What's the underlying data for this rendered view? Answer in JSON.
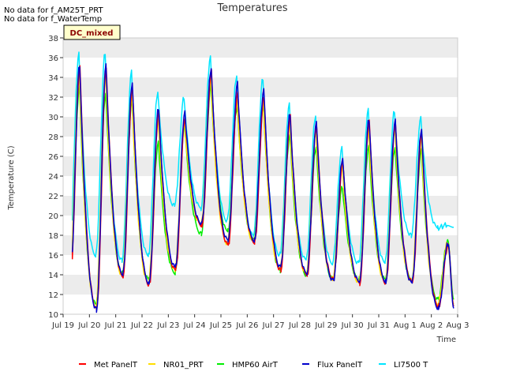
{
  "notices": [
    "No data for f_AM25T_PRT",
    "No data for f_WaterTemp"
  ],
  "badge": "DC_mixed",
  "chart_data": {
    "type": "line",
    "title": "Temperatures",
    "xlabel": "Time",
    "ylabel": "Temperature (C)",
    "ylim": [
      10,
      38
    ],
    "yticks": [
      10,
      12,
      14,
      16,
      18,
      20,
      22,
      24,
      26,
      28,
      30,
      32,
      34,
      36,
      38
    ],
    "xlim": [
      "2024-07-19",
      "2024-08-03"
    ],
    "xticks": [
      "Jul 19",
      "Jul 20",
      "Jul 21",
      "Jul 22",
      "Jul 23",
      "Jul 24",
      "Jul 25",
      "Jul 26",
      "Jul 27",
      "Jul 28",
      "Jul 29",
      "Jul 30",
      "Jul 31",
      "Aug 1",
      "Aug 2",
      "Aug 3"
    ],
    "grid": "horizontal bands",
    "legend": "bottom",
    "days": [
      "Jul 19",
      "Jul 20",
      "Jul 21",
      "Jul 22",
      "Jul 23",
      "Jul 24",
      "Jul 25",
      "Jul 26",
      "Jul 27",
      "Jul 28",
      "Jul 29",
      "Jul 30",
      "Jul 31",
      "Aug 1",
      "Aug 2"
    ],
    "series": [
      {
        "name": "Met PanelT",
        "color": "#ff0000",
        "daily_min": [
          13.5,
          10.5,
          13.8,
          13.0,
          14.5,
          19.0,
          17.0,
          17.3,
          14.5,
          14.0,
          13.5,
          13.2,
          13.2,
          13.3,
          10.8
        ],
        "daily_max": [
          35.0,
          35.0,
          33.0,
          30.5,
          30.0,
          34.5,
          32.5,
          32.0,
          30.0,
          29.0,
          25.5,
          29.5,
          29.3,
          28.5,
          17.0
        ]
      },
      {
        "name": "NR01_PRT",
        "color": "#ffdd00",
        "daily_min": [
          13.6,
          10.8,
          14.0,
          13.2,
          14.6,
          19.1,
          17.2,
          17.4,
          14.6,
          14.1,
          13.6,
          13.3,
          13.3,
          13.4,
          11.0
        ],
        "daily_max": [
          34.5,
          34.5,
          32.5,
          30.0,
          29.5,
          34.0,
          32.0,
          31.5,
          29.5,
          28.5,
          25.0,
          29.0,
          28.8,
          28.0,
          17.2
        ]
      },
      {
        "name": "HMP60 AirT",
        "color": "#00ee00",
        "daily_min": [
          14.0,
          11.0,
          14.2,
          13.5,
          14.2,
          18.2,
          18.5,
          17.5,
          14.5,
          14.0,
          13.6,
          13.5,
          13.5,
          13.5,
          11.5
        ],
        "daily_max": [
          33.0,
          32.5,
          31.5,
          27.5,
          29.0,
          33.0,
          31.0,
          31.0,
          28.0,
          27.0,
          23.0,
          27.0,
          27.0,
          26.5,
          17.5
        ]
      },
      {
        "name": "Flux PanelT",
        "color": "#0000cc",
        "daily_min": [
          13.3,
          10.5,
          14.0,
          13.2,
          14.8,
          19.2,
          17.5,
          17.5,
          14.8,
          14.2,
          13.4,
          13.3,
          13.4,
          13.2,
          10.6
        ],
        "daily_max": [
          35.3,
          35.2,
          33.5,
          31.0,
          30.5,
          35.0,
          33.3,
          32.8,
          30.3,
          29.3,
          25.8,
          29.8,
          29.6,
          28.8,
          17.2
        ]
      },
      {
        "name": "LI7500 T",
        "color": "#00e5ff",
        "daily_min": [
          16.5,
          16.0,
          15.5,
          16.0,
          21.0,
          20.8,
          19.5,
          18.0,
          16.0,
          15.5,
          15.2,
          15.2,
          15.3,
          18.0,
          18.8
        ],
        "daily_max": [
          36.5,
          36.5,
          34.5,
          32.5,
          32.0,
          36.0,
          34.2,
          34.0,
          31.3,
          30.2,
          26.7,
          30.8,
          30.6,
          29.8,
          19.0
        ]
      }
    ]
  }
}
